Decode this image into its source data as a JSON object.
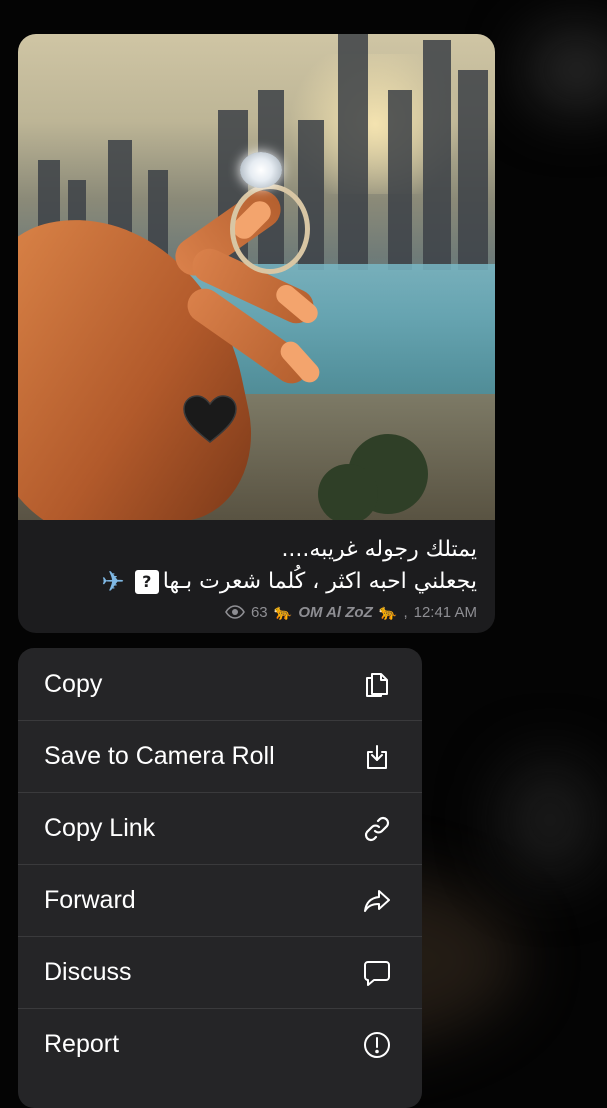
{
  "message": {
    "caption_line1": "يمتلك رجوله غريبه....",
    "caption_line2": "يجعلني احبه اكثر ، كُلما شعرت بـها",
    "unknown_glyph": "?",
    "views": "63",
    "author": "OM Al ZoZ",
    "time": "12:41 AM"
  },
  "menu": {
    "items": [
      {
        "label": "Copy",
        "icon": "copy-icon"
      },
      {
        "label": "Save to Camera Roll",
        "icon": "save-icon"
      },
      {
        "label": "Copy Link",
        "icon": "link-icon"
      },
      {
        "label": "Forward",
        "icon": "forward-icon"
      },
      {
        "label": "Discuss",
        "icon": "discuss-icon"
      },
      {
        "label": "Report",
        "icon": "report-icon"
      }
    ]
  },
  "colors": {
    "background": "#040404",
    "bubble": "#1c1c1e",
    "menu": "#252527",
    "meta_text": "#8e8e93"
  }
}
